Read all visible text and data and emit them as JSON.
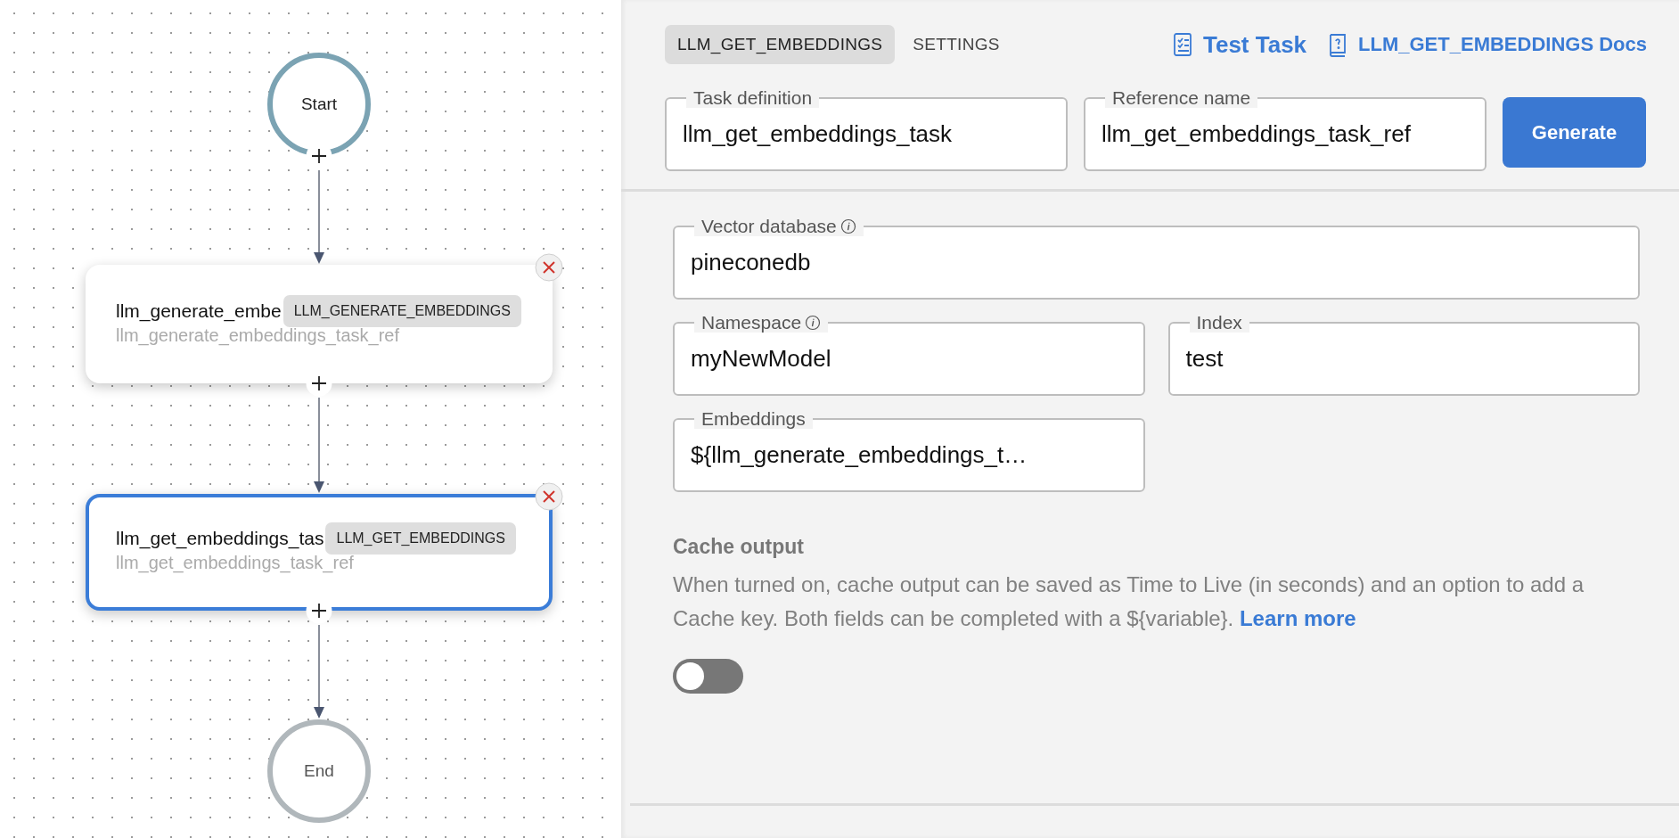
{
  "diagram": {
    "nodes": [
      {
        "kind": "start",
        "label": "Start"
      },
      {
        "kind": "task",
        "title": "llm_generate_embe",
        "type": "LLM_GENERATE_EMBEDDINGS",
        "ref": "llm_generate_embeddings_task_ref",
        "selected": false
      },
      {
        "kind": "task",
        "title": "llm_get_embeddings_tas",
        "type": "LLM_GET_EMBEDDINGS",
        "ref": "llm_get_embeddings_task_ref",
        "selected": true
      },
      {
        "kind": "end",
        "label": "End"
      }
    ]
  },
  "panel": {
    "tabs": [
      {
        "label": "LLM_GET_EMBEDDINGS",
        "selected": true
      },
      {
        "label": "SETTINGS",
        "selected": false
      }
    ],
    "links": [
      {
        "kind": "test",
        "label": "Test Task"
      },
      {
        "kind": "docs",
        "label": "LLM_GET_EMBEDDINGS Docs"
      }
    ],
    "header_fields": [
      {
        "label": "Task definition",
        "value": "llm_get_embeddings_task"
      },
      {
        "label": "Reference name",
        "value": "llm_get_embeddings_task_ref"
      }
    ],
    "generate_button": "Generate",
    "fields": [
      {
        "label": "Vector database",
        "value": "pineconedb",
        "info": true,
        "kind": "wide"
      },
      {
        "label": "Namespace",
        "value": "myNewModel",
        "info": true,
        "kind": "narrow"
      },
      {
        "label": "Index",
        "value": "test",
        "info": false,
        "kind": "narrow"
      },
      {
        "label": "Embeddings",
        "value": "${llm_generate_embeddings_t…",
        "info": false,
        "kind": "narrow"
      }
    ],
    "cache": {
      "title": "Cache output",
      "description": "When turned on, cache output can be saved as Time to Live (in seconds) and an option to add a Cache key. Both fields can be completed with a ${variable}.",
      "link": "Learn more",
      "on": false
    }
  }
}
